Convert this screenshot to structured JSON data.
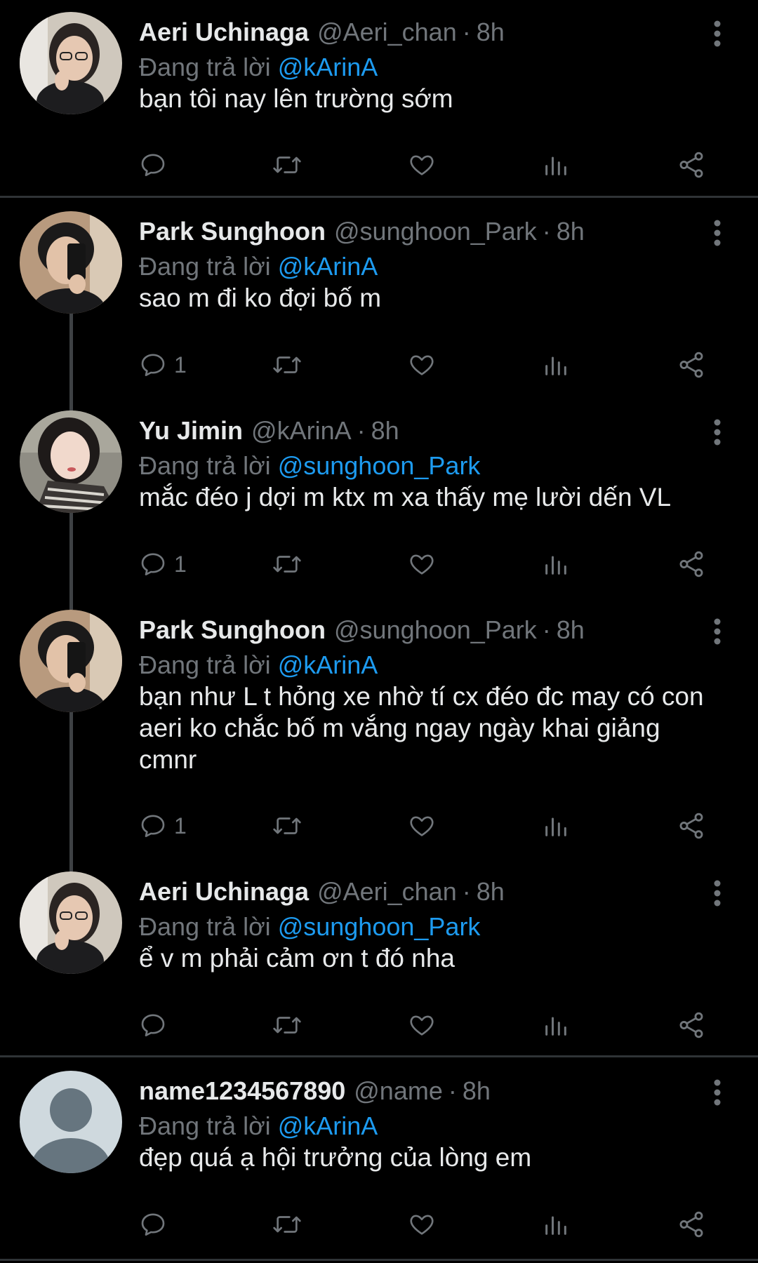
{
  "replies": [
    {
      "name": "Aeri Uchinaga",
      "handle": "@Aeri_chan",
      "time": "8h",
      "replying_to_prefix": "Đang trả lời",
      "replying_to": "@kArinA",
      "text": "bạn tôi nay lên trường sớm",
      "reply_count": ""
    },
    {
      "name": "Park Sunghoon",
      "handle": "@sunghoon_Park",
      "time": "8h",
      "replying_to_prefix": "Đang trả lời",
      "replying_to": "@kArinA",
      "text": "sao m đi ko đợi bố m",
      "reply_count": "1"
    },
    {
      "name": "Yu Jimin",
      "handle": "@kArinA",
      "time": "8h",
      "replying_to_prefix": "Đang trả lời",
      "replying_to": "@sunghoon_Park",
      "text": "mắc đéo j dợi m ktx m xa thấy mẹ lười dến VL",
      "reply_count": "1"
    },
    {
      "name": "Park Sunghoon",
      "handle": "@sunghoon_Park",
      "time": "8h",
      "replying_to_prefix": "Đang trả lời",
      "replying_to": "@kArinA",
      "text": "bạn như L t hỏng xe nhờ tí cx đéo đc may có con aeri ko chắc bố m vắng ngay ngày khai giảng cmnr",
      "reply_count": "1"
    },
    {
      "name": "Aeri Uchinaga",
      "handle": "@Aeri_chan",
      "time": "8h",
      "replying_to_prefix": "Đang trả lời",
      "replying_to": "@sunghoon_Park",
      "text": "ể v m phải cảm ơn t đó nha",
      "reply_count": ""
    },
    {
      "name": "name1234567890",
      "handle": "@name",
      "time": "8h",
      "replying_to_prefix": "Đang trả lời",
      "replying_to": "@kArinA",
      "text": "đẹp quá ạ hội trưởng của lòng em",
      "reply_count": ""
    }
  ],
  "separator": "·",
  "icons": {
    "reply": "reply-icon",
    "retweet": "retweet-icon",
    "like": "heart-icon",
    "views": "views-icon",
    "share": "share-icon",
    "more": "more-vertical-icon"
  },
  "colors": {
    "background": "#000000",
    "name": "#e7e9ea",
    "secondary": "#71767b",
    "mention": "#1d9bf0",
    "divider": "#2f3336",
    "thread_line": "#3e4144"
  }
}
